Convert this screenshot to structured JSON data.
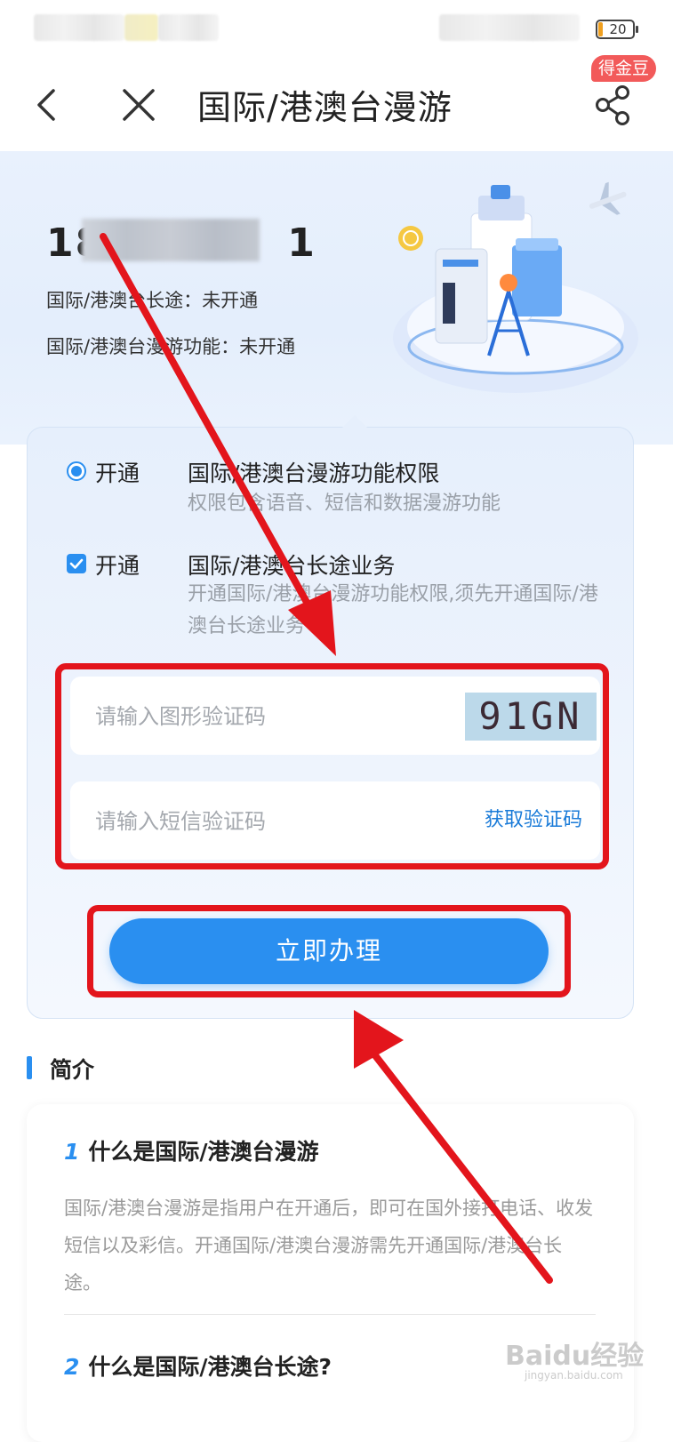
{
  "status_bar": {
    "battery": "20"
  },
  "nav": {
    "title": "国际/港澳台漫游",
    "badge": "得金豆"
  },
  "hero": {
    "phone_prefix": "18",
    "phone_suffix": "1",
    "status_1": "国际/港澳台长途：未开通",
    "status_2": "国际/港澳台漫游功能：未开通"
  },
  "form": {
    "option_1": {
      "label": "开通",
      "title": "国际/港澳台漫游功能权限",
      "desc": "权限包含语音、短信和数据漫游功能"
    },
    "option_2": {
      "label": "开通",
      "title": "国际/港澳台长途业务",
      "desc": "开通国际/港澳台漫游功能权限,须先开通国际/港澳台长途业务"
    },
    "captcha_placeholder": "请输入图形验证码",
    "captcha_text": "91GN",
    "sms_placeholder": "请输入短信验证码",
    "get_code": "获取验证码",
    "submit": "立即办理"
  },
  "intro": {
    "title": "简介",
    "q1_num": "1",
    "q1": "什么是国际/港澳台漫游",
    "a1": "国际/港澳台漫游是指用户在开通后，即可在国外接打电话、收发短信以及彩信。开通国际/港澳台漫游需先开通国际/港澳台长途。",
    "q2_num": "2",
    "q2": "什么是国际/港澳台长途?"
  },
  "watermark": {
    "main": "Baidu经验",
    "sub": "jingyan.baidu.com"
  },
  "colors": {
    "accent": "#2a8ff0",
    "annotation": "#e3151c",
    "link": "#1a7bd8"
  }
}
